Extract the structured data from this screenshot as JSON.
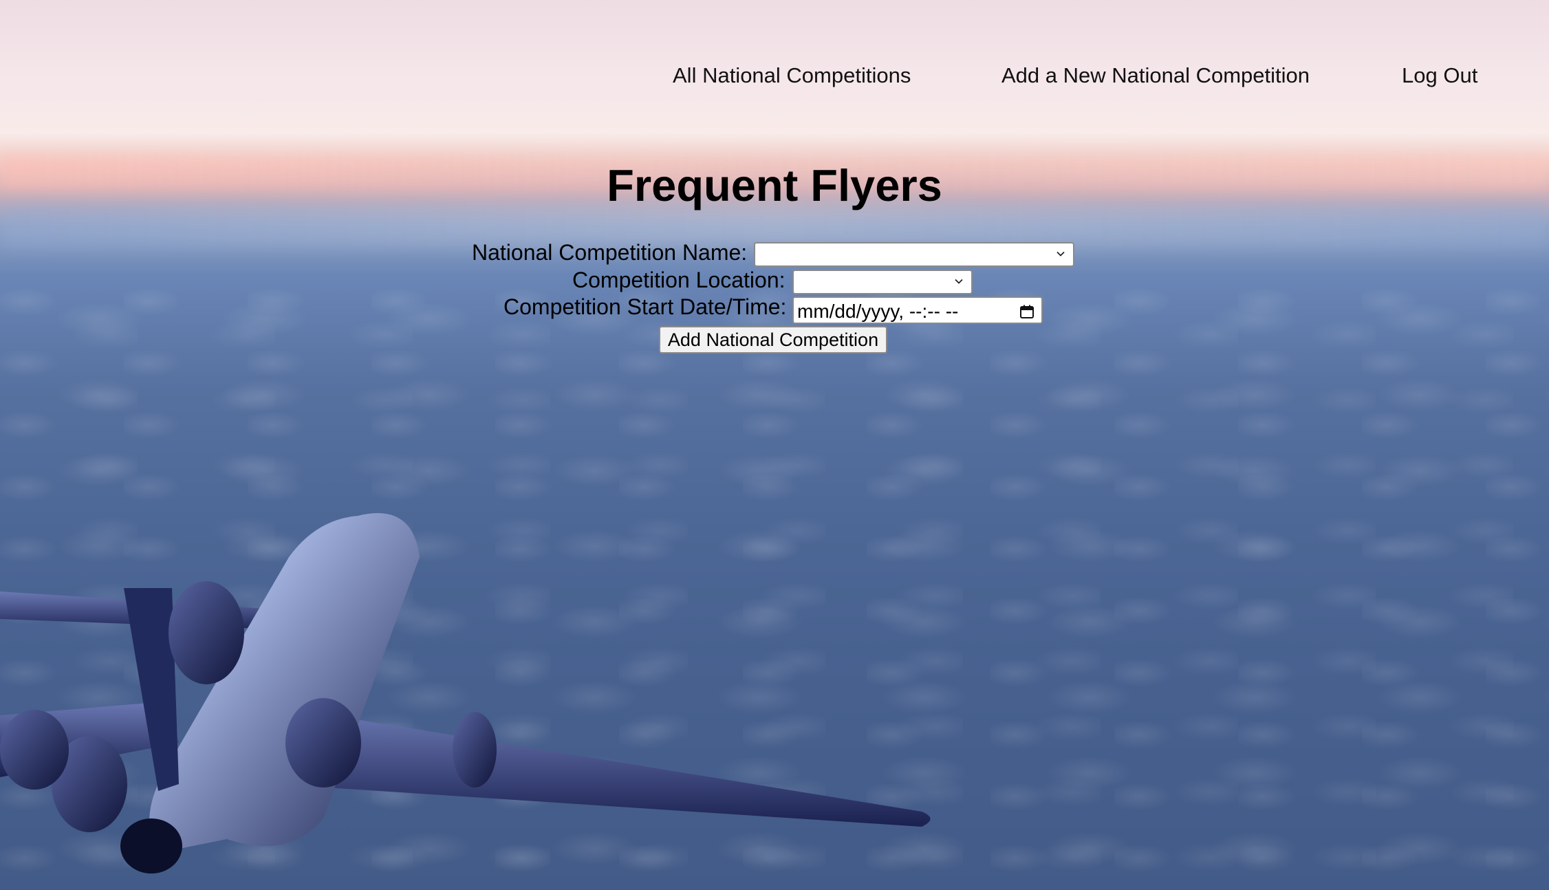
{
  "nav": {
    "all_competitions": "All National Competitions",
    "add_competition": "Add a New National Competition",
    "logout": "Log Out"
  },
  "header": {
    "title": "Frequent Flyers"
  },
  "form": {
    "name_label": "National Competition Name:",
    "name_value": "",
    "location_label": "Competition Location:",
    "location_value": "",
    "start_label": "Competition Start Date/Time:",
    "start_placeholder": "mm/dd/yyyy, --:-- --",
    "submit_label": "Add National Competition"
  },
  "icons": {
    "dropdown": "chevron-down-icon",
    "date_picker": "calendar-icon"
  },
  "colors": {
    "sky_top": "#eedde3",
    "sky_bottom": "#435b88",
    "text": "#000000"
  }
}
